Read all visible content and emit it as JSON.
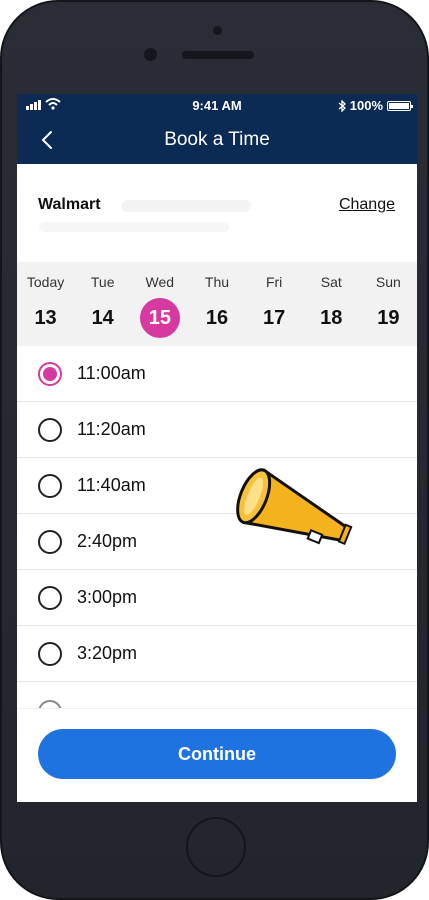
{
  "status_bar": {
    "time": "9:41 AM",
    "battery": "100%"
  },
  "nav": {
    "title": "Book a Time"
  },
  "store": {
    "name": "Walmart",
    "change_label": "Change"
  },
  "week": [
    {
      "day": "Today",
      "date": "13",
      "selected": false
    },
    {
      "day": "Tue",
      "date": "14",
      "selected": false
    },
    {
      "day": "Wed",
      "date": "15",
      "selected": true
    },
    {
      "day": "Thu",
      "date": "16",
      "selected": false
    },
    {
      "day": "Fri",
      "date": "17",
      "selected": false
    },
    {
      "day": "Sat",
      "date": "18",
      "selected": false
    },
    {
      "day": "Sun",
      "date": "19",
      "selected": false
    }
  ],
  "time_slots": [
    {
      "label": "11:00am",
      "selected": true
    },
    {
      "label": "11:20am",
      "selected": false
    },
    {
      "label": "11:40am",
      "selected": false
    },
    {
      "label": "2:40pm",
      "selected": false
    },
    {
      "label": "3:00pm",
      "selected": false
    },
    {
      "label": "3:20pm",
      "selected": false
    }
  ],
  "footer": {
    "continue_label": "Continue"
  },
  "colors": {
    "nav_bg": "#0b2a54",
    "accent": "#d6399f",
    "button": "#1e73e0",
    "megaphone": "#f5b21f"
  }
}
